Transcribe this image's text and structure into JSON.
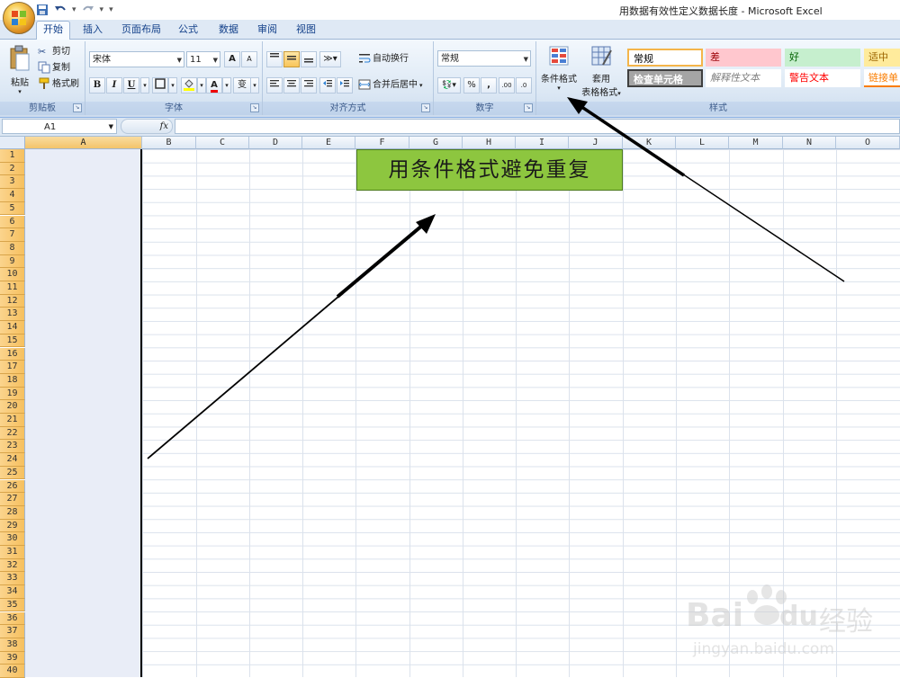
{
  "window": {
    "title": "用数据有效性定义数据长度 - Microsoft Excel"
  },
  "quick_access": {
    "save_icon": "save-icon",
    "undo_icon": "undo-icon",
    "redo_icon": "redo-icon",
    "customize": "▾"
  },
  "tabs": [
    "开始",
    "插入",
    "页面布局",
    "公式",
    "数据",
    "审阅",
    "视图"
  ],
  "active_tab": "开始",
  "ribbon": {
    "clipboard": {
      "label": "剪贴板",
      "paste": "粘贴",
      "cut": "剪切",
      "copy": "复制",
      "format_painter": "格式刷"
    },
    "font": {
      "label": "字体",
      "font_name": "宋体",
      "font_size": "11",
      "grow": "A",
      "shrink": "A",
      "bold": "B",
      "italic": "I",
      "underline": "U",
      "phonetic": "变",
      "font_color_letter": "A"
    },
    "alignment": {
      "label": "对齐方式",
      "wrap_text": "自动换行",
      "merge_center": "合并后居中"
    },
    "number": {
      "label": "数字",
      "format": "常规",
      "percent": "%",
      "comma": ",",
      "inc_decimal": ".00",
      "dec_decimal": ".0"
    },
    "styles": {
      "label": "样式",
      "conditional_formatting": "条件格式",
      "format_as_table_line1": "套用",
      "format_as_table_line2": "表格格式",
      "cells": [
        {
          "text": "常规",
          "bg": "#ffffff",
          "color": "#000000"
        },
        {
          "text": "差",
          "bg": "#ffc7ce",
          "color": "#9c0006"
        },
        {
          "text": "好",
          "bg": "#c6efce",
          "color": "#006100"
        },
        {
          "text": "适中",
          "bg": "#ffeb9c",
          "color": "#9c6500"
        },
        {
          "text": "检查单元格",
          "bg": "#a5a5a5",
          "color": "#ffffff"
        },
        {
          "text": "解释性文本",
          "bg": "#ffffff",
          "color": "#7f7f7f"
        },
        {
          "text": "警告文本",
          "bg": "#ffffff",
          "color": "#ff0000"
        },
        {
          "text": "链接单",
          "bg": "#ffffff",
          "color": "#fa7d00"
        }
      ]
    }
  },
  "formula_bar": {
    "name_box": "A1",
    "fx": "fx",
    "value": ""
  },
  "columns": [
    "A",
    "B",
    "C",
    "D",
    "E",
    "F",
    "G",
    "H",
    "I",
    "J",
    "K",
    "L",
    "M",
    "N",
    "O"
  ],
  "rows": [
    "1",
    "2",
    "3",
    "4",
    "5",
    "6",
    "7",
    "8",
    "9",
    "10",
    "11",
    "12",
    "13",
    "14",
    "15",
    "16",
    "17",
    "18",
    "19",
    "20",
    "21",
    "22",
    "23",
    "24",
    "25",
    "26",
    "27",
    "28",
    "29",
    "30",
    "31",
    "32",
    "33",
    "34",
    "35",
    "36",
    "37",
    "38",
    "39",
    "40"
  ],
  "sheet": {
    "merged_title": "用条件格式避免重复",
    "merged_bg": "#8dc63f"
  },
  "watermark": {
    "line1": "Bai",
    "line2": "du",
    "cn": "经验",
    "url": "jingyan.baidu.com"
  }
}
